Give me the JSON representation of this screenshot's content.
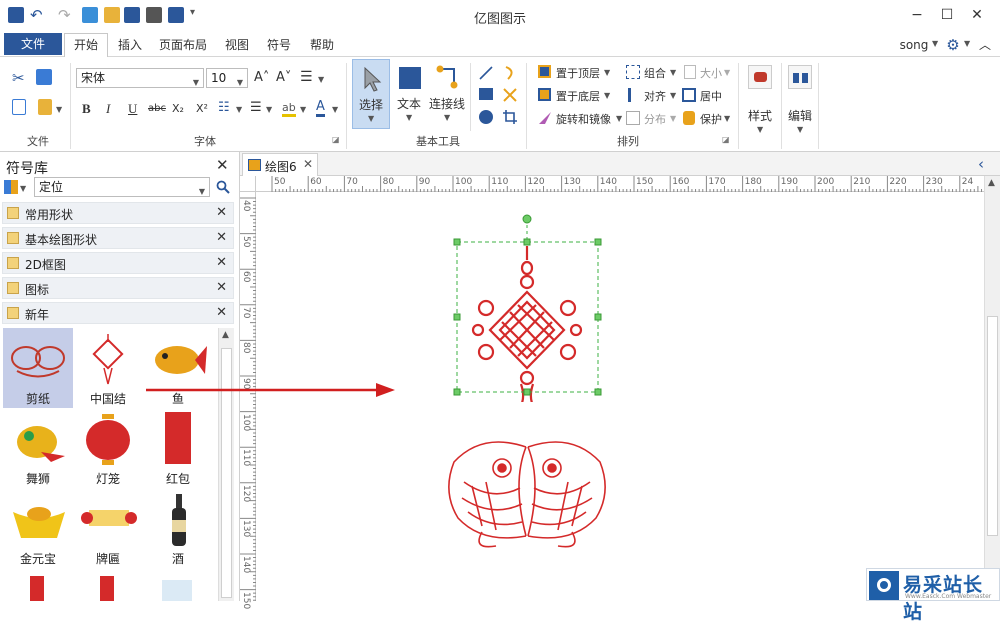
{
  "app": {
    "title": "亿图图示"
  },
  "window": {
    "minimize": "−",
    "maximize": "☐",
    "close": "✕"
  },
  "menu": {
    "file": "文件",
    "tabs": [
      "开始",
      "插入",
      "页面布局",
      "视图",
      "符号",
      "帮助"
    ],
    "user": "song",
    "gear": "⚙",
    "collapse": "︿"
  },
  "ribbon": {
    "groups": {
      "file": "文件",
      "font": "字体",
      "basic_tools": "基本工具",
      "arrange": "排列"
    },
    "font_name": "宋体",
    "font_size": "10",
    "font_buttons": {
      "bold": "B",
      "italic": "I",
      "underline": "U",
      "strike": "abc",
      "sub": "X₂",
      "sup": "X²",
      "grow": "A˄",
      "shrink": "A˅"
    },
    "tools": {
      "select": "选择",
      "text": "文本",
      "connector": "连接线"
    },
    "arrange": {
      "bring_front": "置于顶层",
      "send_back": "置于底层",
      "rotate": "旋转和镜像",
      "group": "组合",
      "align": "对齐",
      "distribute": "分布",
      "size": "大小",
      "center": "居中",
      "protect": "保护"
    },
    "style": "样式",
    "edit": "编辑"
  },
  "sidebar": {
    "title": "符号库",
    "search_value": "定位",
    "libraries": [
      "常用形状",
      "基本绘图形状",
      "2D框图",
      "图标",
      "新年"
    ],
    "shapes": [
      "剪纸",
      "中国结",
      "鱼",
      "舞狮",
      "灯笼",
      "红包",
      "金元宝",
      "牌匾",
      "酒"
    ]
  },
  "document": {
    "tab_name": "绘图6",
    "hruler": [
      "50",
      "60",
      "70",
      "80",
      "90",
      "100",
      "110",
      "120",
      "130",
      "140",
      "150",
      "160",
      "170",
      "180",
      "190",
      "200",
      "210",
      "220",
      "230",
      "24"
    ],
    "vruler": [
      "40",
      "50",
      "60",
      "70",
      "80",
      "90",
      "100",
      "110",
      "120",
      "130",
      "140",
      "150"
    ]
  },
  "watermark": {
    "text": "易采站长站",
    "sub": "Www.Easck.Com Webmaster"
  },
  "colors": {
    "accent": "#2b579a",
    "knot_red": "#d42a2a",
    "selection": "#3cb043",
    "arrow": "#d11f1f"
  }
}
